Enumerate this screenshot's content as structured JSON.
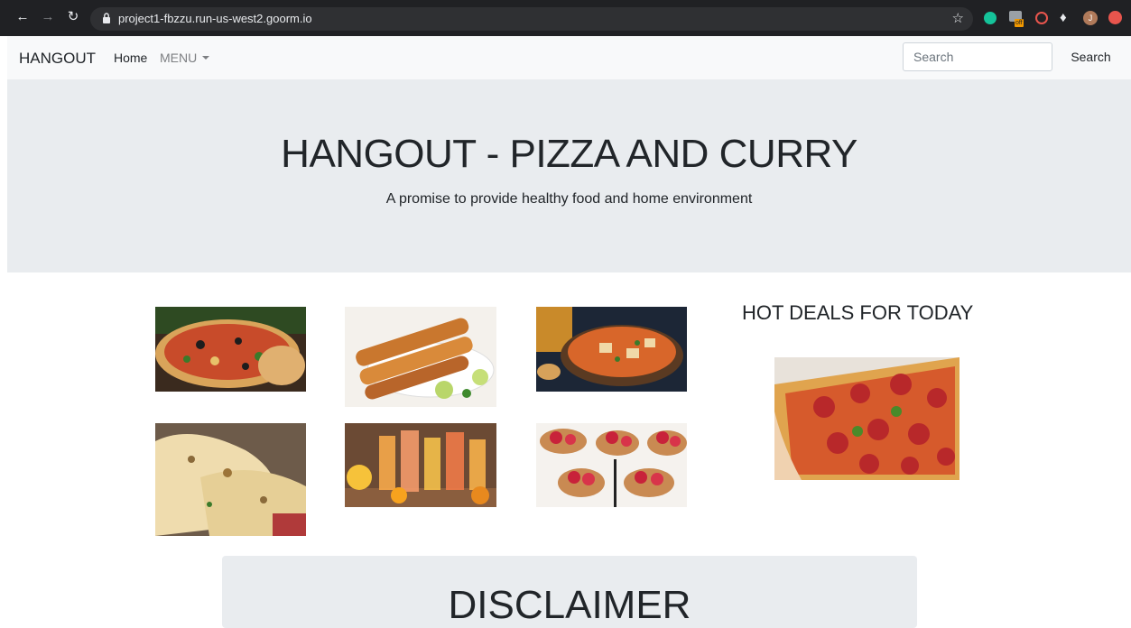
{
  "browser": {
    "url": "project1-fbzzu.run-us-west2.goorm.io",
    "profile_initial": "J",
    "extension_badge": "off"
  },
  "nav": {
    "brand": "HANGOUT",
    "home": "Home",
    "menu": "MENU",
    "search_placeholder": "Search",
    "search_button": "Search"
  },
  "hero": {
    "title": "HANGOUT - PIZZA AND CURRY",
    "subtitle": "A promise to provide healthy food and home environment"
  },
  "deals": {
    "title": "HOT DEALS FOR TODAY"
  },
  "disclaimer": {
    "title": "DISCLAIMER"
  },
  "colors": {
    "chrome": "#202124",
    "navbar": "#f8f9fa",
    "jumbotron": "#e9ecef",
    "text": "#212529"
  }
}
